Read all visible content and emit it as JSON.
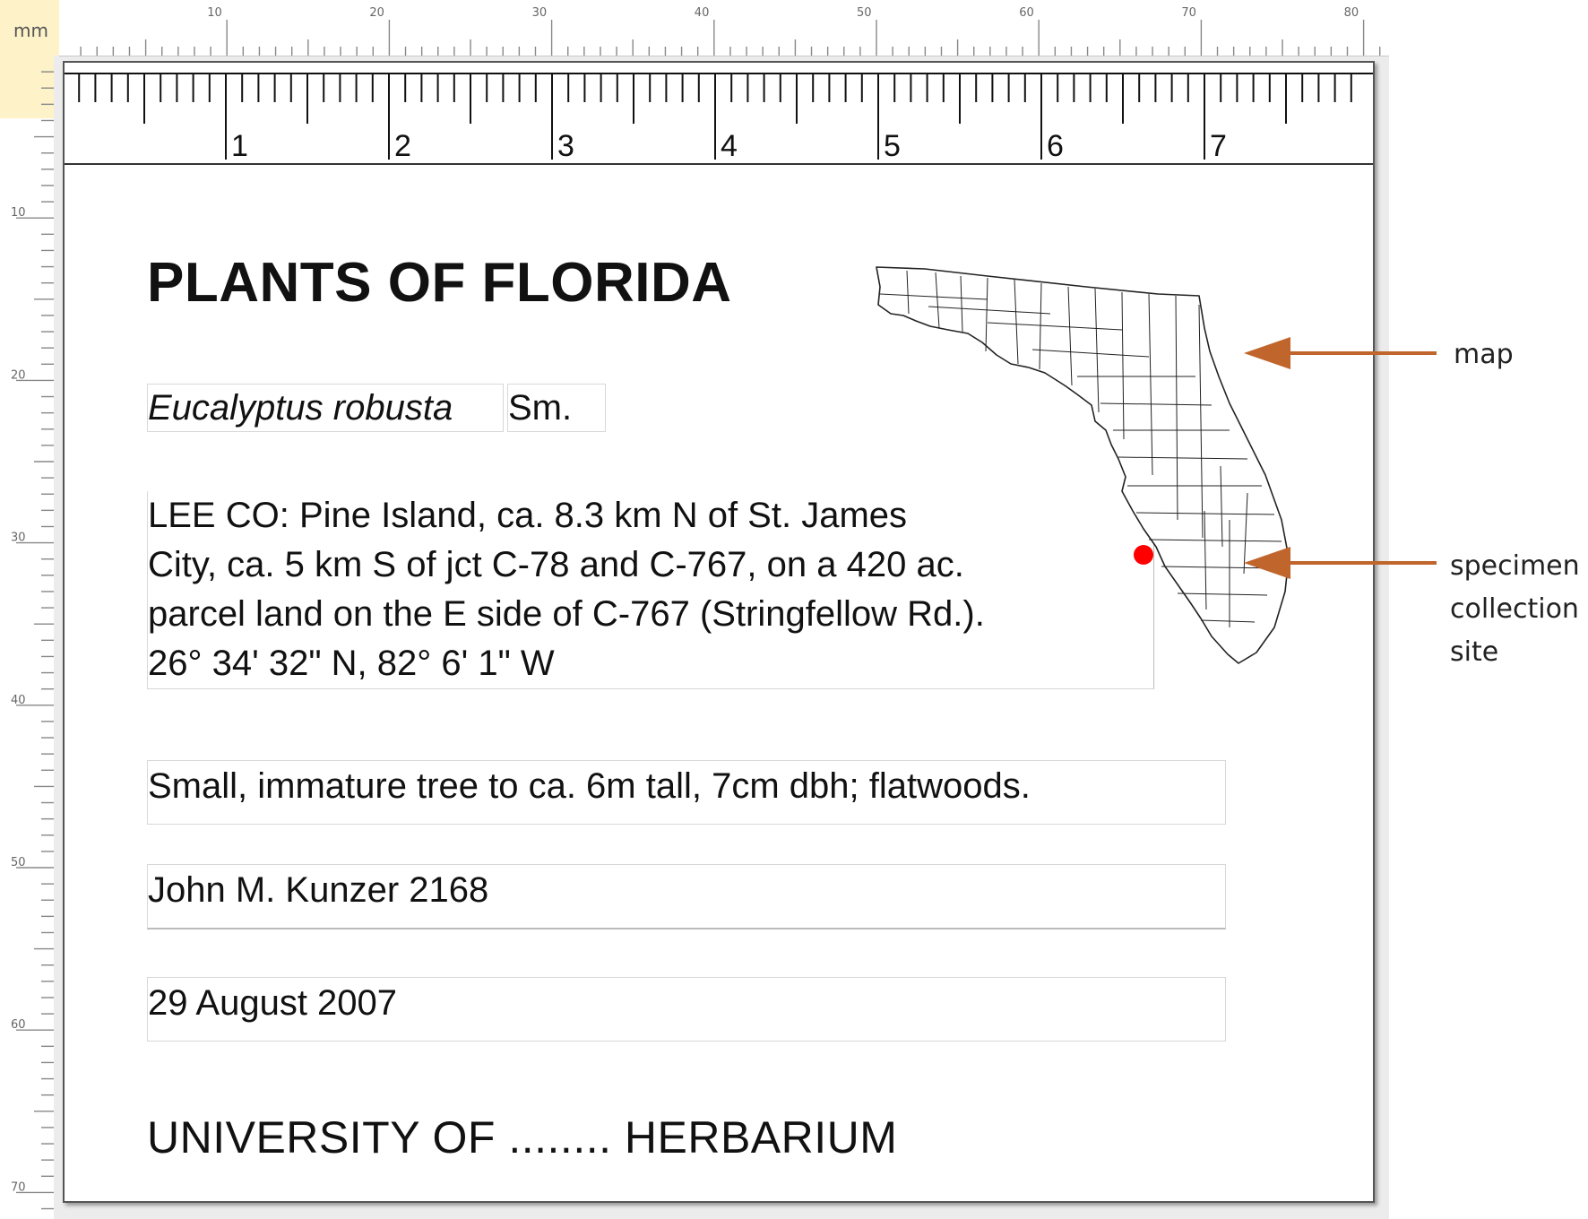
{
  "ruler": {
    "unit_label": "mm",
    "top_numbers": [
      "10",
      "20",
      "30",
      "40",
      "50",
      "60",
      "70",
      "80"
    ],
    "left_numbers": [
      "10",
      "20",
      "30",
      "40",
      "50",
      "60",
      "70"
    ]
  },
  "label": {
    "inch_numbers": [
      "1",
      "2",
      "3",
      "4",
      "5",
      "6",
      "7"
    ],
    "title": "PLANTS OF FLORIDA",
    "scientific_name": "Eucalyptus robusta",
    "authority": "Sm.",
    "locality_lines": [
      "LEE CO: Pine Island, ca. 8.3 km N of St. James",
      "City, ca. 5 km S of jct C-78 and C-767, on a 420 ac.",
      "parcel land on the E side of C-767 (Stringfellow Rd.).",
      "26° 34' 32\" N, 82° 6' 1\" W"
    ],
    "habitat": "Small, immature tree to ca. 6m tall, 7cm dbh; flatwoods.",
    "collector": "John M. Kunzer 2168",
    "date": "29 August 2007",
    "herbarium": "UNIVERSITY OF ........ HERBARIUM"
  },
  "annotations": {
    "map": "map",
    "site_lines": [
      "specimen",
      "collection",
      "site"
    ]
  },
  "colors": {
    "arrow": "#c0652c",
    "site_marker": "#ff0000",
    "ruler_highlight": "#fdf2c8"
  }
}
